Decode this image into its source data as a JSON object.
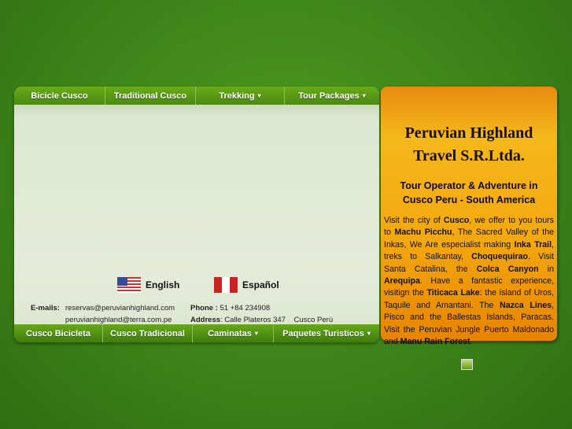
{
  "top_nav": [
    {
      "label": "Bicicle Cusco",
      "dropdown": false
    },
    {
      "label": "Traditional Cusco",
      "dropdown": false
    },
    {
      "label": "Trekking",
      "dropdown": true
    },
    {
      "label": "Tour Packages",
      "dropdown": true
    }
  ],
  "bottom_nav": [
    {
      "label": "Cusco Bicicleta",
      "dropdown": false
    },
    {
      "label": "Cusco Tradicional",
      "dropdown": false
    },
    {
      "label": "Caminatas",
      "dropdown": true
    },
    {
      "label": "Paquetes Turisticos",
      "dropdown": true
    }
  ],
  "caret": "▾",
  "languages": {
    "english": "English",
    "spanish": "Español"
  },
  "contact": {
    "emails_label": "E-mails:",
    "email1": "reservas@peruvianhighland.com",
    "email2": "peruvianhighland@terra.com.pe",
    "phone_label": "Phone :",
    "phone": "51 +84 234908",
    "address_label": "Address",
    "address": ": Calle Plateros 347    Cusco Perú"
  },
  "company": {
    "title_line1": "Peruvian Highland",
    "title_line2": "Travel S.R.Ltda.",
    "subtitle_line1": "Tour Operator & Adventure in",
    "subtitle_line2": "Cusco Peru - South America"
  },
  "description": [
    {
      "t": "Visit the city of ",
      "b": false
    },
    {
      "t": "Cusco",
      "b": true
    },
    {
      "t": ", we offer to you tours to ",
      "b": false
    },
    {
      "t": "Machu Picchu",
      "b": true
    },
    {
      "t": ", The Sacred Valley of the Inkas, We Are especialist making ",
      "b": false
    },
    {
      "t": "Inka Trail",
      "b": true
    },
    {
      "t": ", treks to Salkantay, ",
      "b": false
    },
    {
      "t": "Choquequirao",
      "b": true
    },
    {
      "t": ". Visit Santa Catalina, the ",
      "b": false
    },
    {
      "t": "Colca Canyon",
      "b": true
    },
    {
      "t": " in ",
      "b": false
    },
    {
      "t": "Arequipa",
      "b": true
    },
    {
      "t": ". Have a fantastic experience, visitign the ",
      "b": false
    },
    {
      "t": "Titicaca Lake",
      "b": true
    },
    {
      "t": ": the island of Uros, Taquile and Amantani. The ",
      "b": false
    },
    {
      "t": "Nazca Lines",
      "b": true
    },
    {
      "t": ", Pisco and the Ballestas Islands, Paracas. Visit the Peruvian Jungle Puerto Maldonado and ",
      "b": false
    },
    {
      "t": "Manu Rain Forest",
      "b": true
    },
    {
      "t": ".",
      "b": false
    }
  ]
}
